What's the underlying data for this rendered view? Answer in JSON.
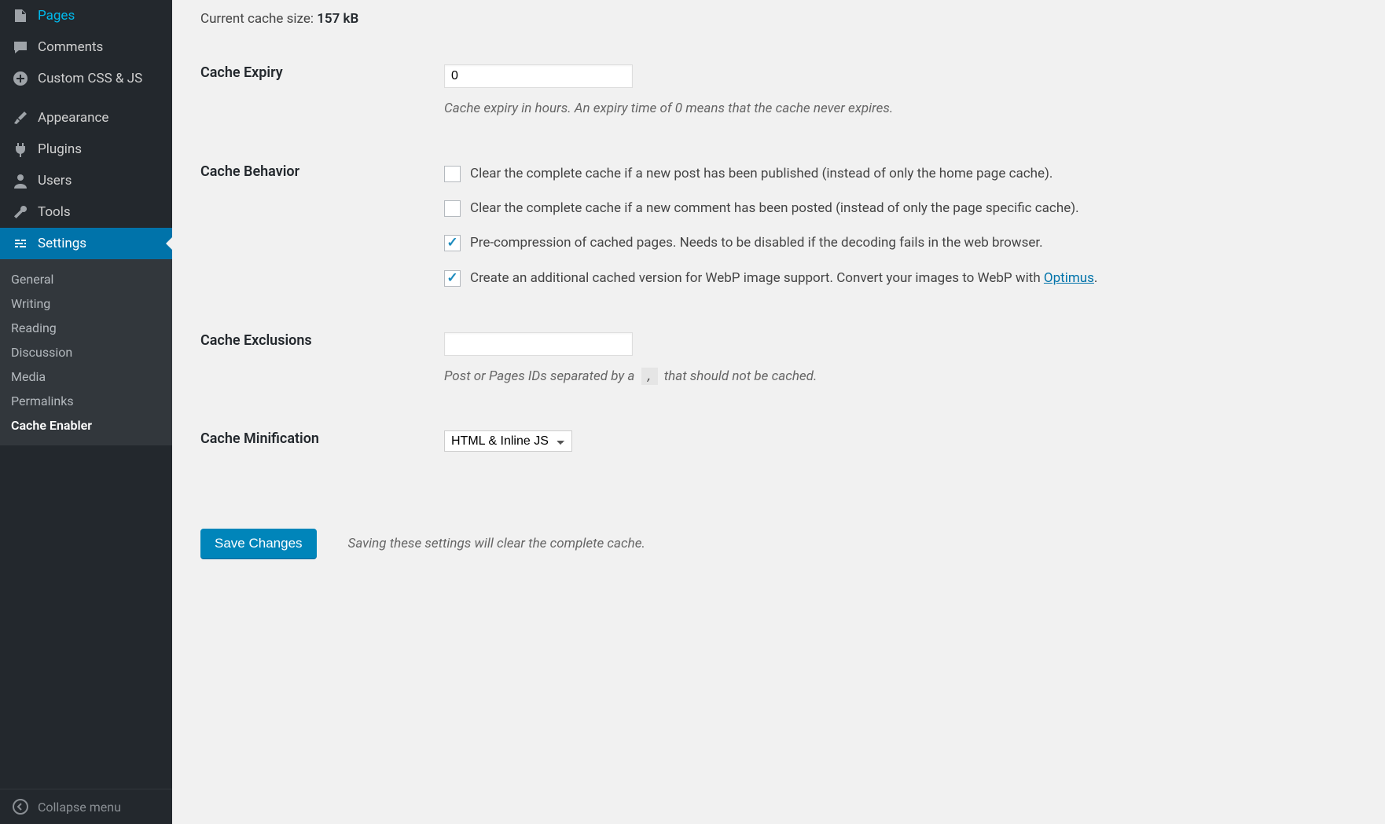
{
  "sidebar": {
    "items": [
      {
        "label": "Pages",
        "icon": "pages"
      },
      {
        "label": "Comments",
        "icon": "comment"
      },
      {
        "label": "Custom CSS & JS",
        "icon": "plus-circle"
      },
      {
        "label": "Appearance",
        "icon": "brush"
      },
      {
        "label": "Plugins",
        "icon": "plug"
      },
      {
        "label": "Users",
        "icon": "user"
      },
      {
        "label": "Tools",
        "icon": "wrench"
      },
      {
        "label": "Settings",
        "icon": "sliders",
        "active": true
      }
    ],
    "submenu": [
      {
        "label": "General"
      },
      {
        "label": "Writing"
      },
      {
        "label": "Reading"
      },
      {
        "label": "Discussion"
      },
      {
        "label": "Media"
      },
      {
        "label": "Permalinks"
      },
      {
        "label": "Cache Enabler",
        "current": true
      }
    ],
    "collapse_label": "Collapse menu"
  },
  "main": {
    "cache_size_label": "Current cache size: ",
    "cache_size_value": "157 kB",
    "rows": {
      "expiry": {
        "heading": "Cache Expiry",
        "value": "0",
        "description": "Cache expiry in hours. An expiry time of 0 means that the cache never expires."
      },
      "behavior": {
        "heading": "Cache Behavior",
        "options": [
          {
            "checked": false,
            "text": "Clear the complete cache if a new post has been published (instead of only the home page cache)."
          },
          {
            "checked": false,
            "text": "Clear the complete cache if a new comment has been posted (instead of only the page specific cache)."
          },
          {
            "checked": true,
            "text": "Pre-compression of cached pages. Needs to be disabled if the decoding fails in the web browser."
          },
          {
            "checked": true,
            "text_prefix": "Create an additional cached version for WebP image support. Convert your images to WebP with ",
            "link_text": "Optimus",
            "text_suffix": "."
          }
        ]
      },
      "exclusions": {
        "heading": "Cache Exclusions",
        "value": "",
        "description_prefix": "Post or Pages IDs separated by a ",
        "description_code": ",",
        "description_suffix": " that should not be cached."
      },
      "minification": {
        "heading": "Cache Minification",
        "selected": "HTML & Inline JS"
      }
    },
    "submit": {
      "button_label": "Save Changes",
      "note": "Saving these settings will clear the complete cache."
    }
  }
}
